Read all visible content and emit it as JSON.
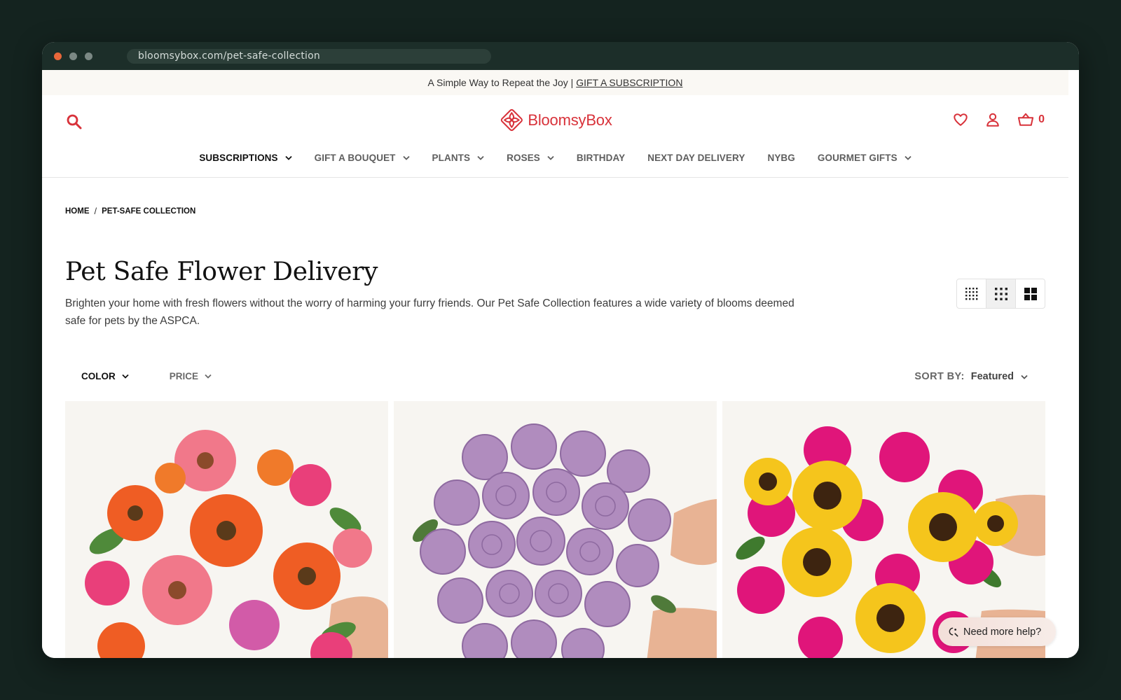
{
  "browser": {
    "url": "bloomsybox.com/pet-safe-collection"
  },
  "announcement": {
    "text": "A Simple Way to Repeat the Joy | ",
    "link": "GIFT A SUBSCRIPTION"
  },
  "header": {
    "logo_text": "BloomsyBox",
    "cart_count": "0"
  },
  "nav": {
    "items": [
      {
        "label": "SUBSCRIPTIONS",
        "dropdown": true
      },
      {
        "label": "GIFT A BOUQUET",
        "dropdown": true
      },
      {
        "label": "PLANTS",
        "dropdown": true
      },
      {
        "label": "ROSES",
        "dropdown": true
      },
      {
        "label": "BIRTHDAY",
        "dropdown": false
      },
      {
        "label": "NEXT DAY DELIVERY",
        "dropdown": false
      },
      {
        "label": "NYBG",
        "dropdown": false
      },
      {
        "label": "GOURMET GIFTS",
        "dropdown": true
      }
    ]
  },
  "breadcrumb": {
    "home": "HOME",
    "separator": "/",
    "current": "PET-SAFE COLLECTION"
  },
  "page": {
    "title": "Pet Safe Flower Delivery",
    "description": "Brighten your home with fresh flowers without the worry of harming your furry friends. Our Pet Safe Collection features a wide variety of blooms deemed safe for pets by the ASPCA."
  },
  "filters": {
    "color_label": "COLOR",
    "price_label": "PRICE"
  },
  "sort": {
    "label": "SORT BY:",
    "value": "Featured"
  },
  "help": {
    "label": "Need more help?"
  },
  "colors": {
    "brand": "#d8323a",
    "window_bg": "#14231f",
    "announcement_bg": "#faf8f4"
  }
}
